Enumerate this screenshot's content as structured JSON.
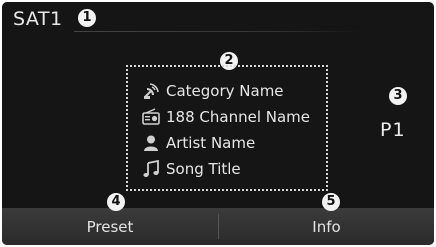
{
  "screen": {
    "title": "SAT1",
    "preset_number": "P1"
  },
  "info": {
    "category": "Category Name",
    "channel": "188 Channel Name",
    "artist": "Artist Name",
    "song": "Song Title"
  },
  "buttons": {
    "preset": "Preset",
    "info": "Info"
  },
  "callouts": [
    "1",
    "2",
    "3",
    "4",
    "5"
  ],
  "colors": {
    "background": "#151515",
    "text": "#e6e6e6",
    "bar": "#333333",
    "callout": "#f2f2f2"
  }
}
